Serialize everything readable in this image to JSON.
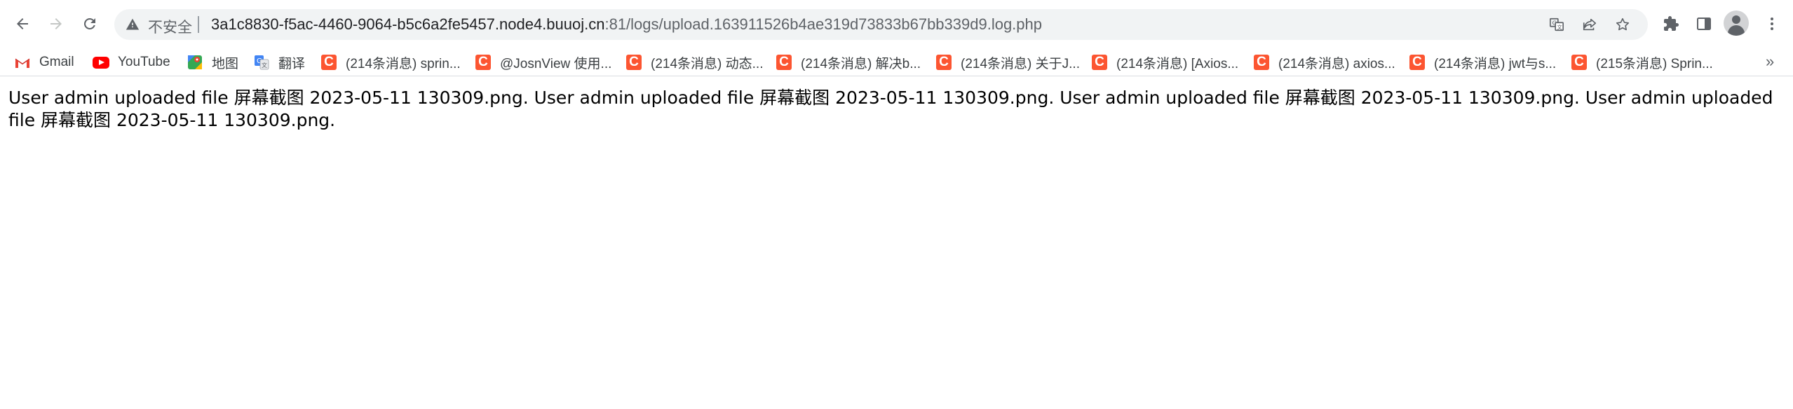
{
  "toolbar": {
    "back_icon": "arrow-left-icon",
    "forward_icon": "arrow-right-icon",
    "reload_icon": "reload-icon",
    "security_label": "不安全",
    "url_host": "3a1c8830-f5ac-4460-9064-b5c6a2fe5457.node4.buuoj.cn",
    "url_path": ":81/logs/upload.163911526b4ae319d73833b67bb339d9.log.php",
    "icons": [
      "translate-icon",
      "share-icon",
      "star-icon",
      "extensions-icon",
      "side-panel-icon",
      "profile-icon",
      "menu-icon"
    ]
  },
  "bookmarks": {
    "items": [
      {
        "label": "Gmail",
        "icon": "gmail-icon"
      },
      {
        "label": "YouTube",
        "icon": "youtube-icon"
      },
      {
        "label": "地图",
        "icon": "maps-icon"
      },
      {
        "label": "翻译",
        "icon": "translate-icon"
      },
      {
        "label": "(214条消息) sprin...",
        "icon": "csdn-icon"
      },
      {
        "label": "@JosnView 使用...",
        "icon": "csdn-icon"
      },
      {
        "label": "(214条消息) 动态...",
        "icon": "csdn-icon"
      },
      {
        "label": "(214条消息) 解决b...",
        "icon": "csdn-icon"
      },
      {
        "label": "(214条消息) 关于J...",
        "icon": "csdn-icon"
      },
      {
        "label": "(214条消息) [Axios...",
        "icon": "csdn-icon"
      },
      {
        "label": "(214条消息) axios...",
        "icon": "csdn-icon"
      },
      {
        "label": "(214条消息) jwt与s...",
        "icon": "csdn-icon"
      },
      {
        "label": "(215条消息) Sprin...",
        "icon": "csdn-icon"
      }
    ],
    "more_label": "»",
    "csdn_glyph": "C"
  },
  "page": {
    "text": "User admin uploaded file 屏幕截图 2023-05-11 130309.png. User admin uploaded file 屏幕截图 2023-05-11 130309.png. User admin uploaded file 屏幕截图 2023-05-11 130309.png. User admin uploaded file 屏幕截图 2023-05-11 130309.png."
  },
  "colors": {
    "csdn_brand": "#fc5531",
    "omnibox_bg": "#f1f3f4",
    "youtube_red": "#ff0000"
  }
}
